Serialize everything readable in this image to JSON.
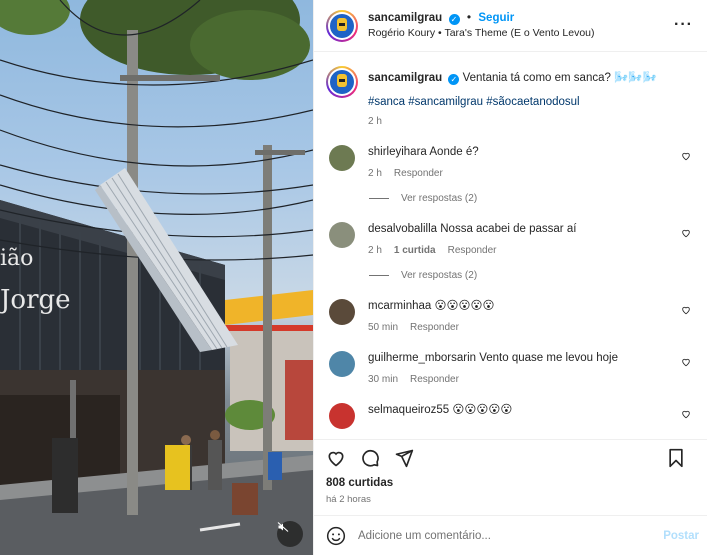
{
  "media": {
    "mute_icon": "speaker-muted-icon",
    "sign_text_1": "ião",
    "sign_text_2": "Jorge"
  },
  "header": {
    "username": "sancamilgrau",
    "verified_icon": "verified-badge-icon",
    "separator": "•",
    "follow_label": "Seguir",
    "audio": "Rogério Koury • Tara's Theme (E o Vento Levou)",
    "more_icon": "more-horizontal-icon"
  },
  "caption": {
    "username": "sancamilgrau",
    "text": "Ventania tá como em sanca? 🌬️🌬️🌬️",
    "tags": "#sanca #sancamilgrau #sãocaetanodosul",
    "time": "2 h"
  },
  "comments": [
    {
      "username": "shirleyihara",
      "text": "Aonde é?",
      "time": "2 h",
      "likes": "",
      "reply_label": "Responder",
      "replies": "Ver respostas (2)",
      "avatar_color": "#6d7a52"
    },
    {
      "username": "desalvobalilla",
      "text": "Nossa acabei de passar aí",
      "time": "2 h",
      "likes": "1 curtida",
      "reply_label": "Responder",
      "replies": "Ver respostas (2)",
      "avatar_color": "#8a8f7c"
    },
    {
      "username": "mcarminhaa",
      "text": "😮😮😮😮😮",
      "time": "50 min",
      "likes": "",
      "reply_label": "Responder",
      "replies": "",
      "avatar_color": "#5a4a3a"
    },
    {
      "username": "guilherme_mborsarin",
      "text": "Vento quase me levou hoje",
      "time": "30 min",
      "likes": "",
      "reply_label": "Responder",
      "replies": "",
      "avatar_color": "#4f86a8"
    },
    {
      "username": "selmaqueiroz55",
      "text": "😮😮😮😮😮",
      "time": "",
      "likes": "",
      "reply_label": "",
      "replies": "",
      "avatar_color": "#c8332f"
    }
  ],
  "actions": {
    "like_icon": "heart-icon",
    "comment_icon": "comment-icon",
    "share_icon": "send-icon",
    "save_icon": "bookmark-icon",
    "likes": "808 curtidas",
    "time": "há 2 horas"
  },
  "add_comment": {
    "emoji_icon": "emoji-icon",
    "placeholder": "Adicione um comentário...",
    "post_label": "Postar"
  }
}
